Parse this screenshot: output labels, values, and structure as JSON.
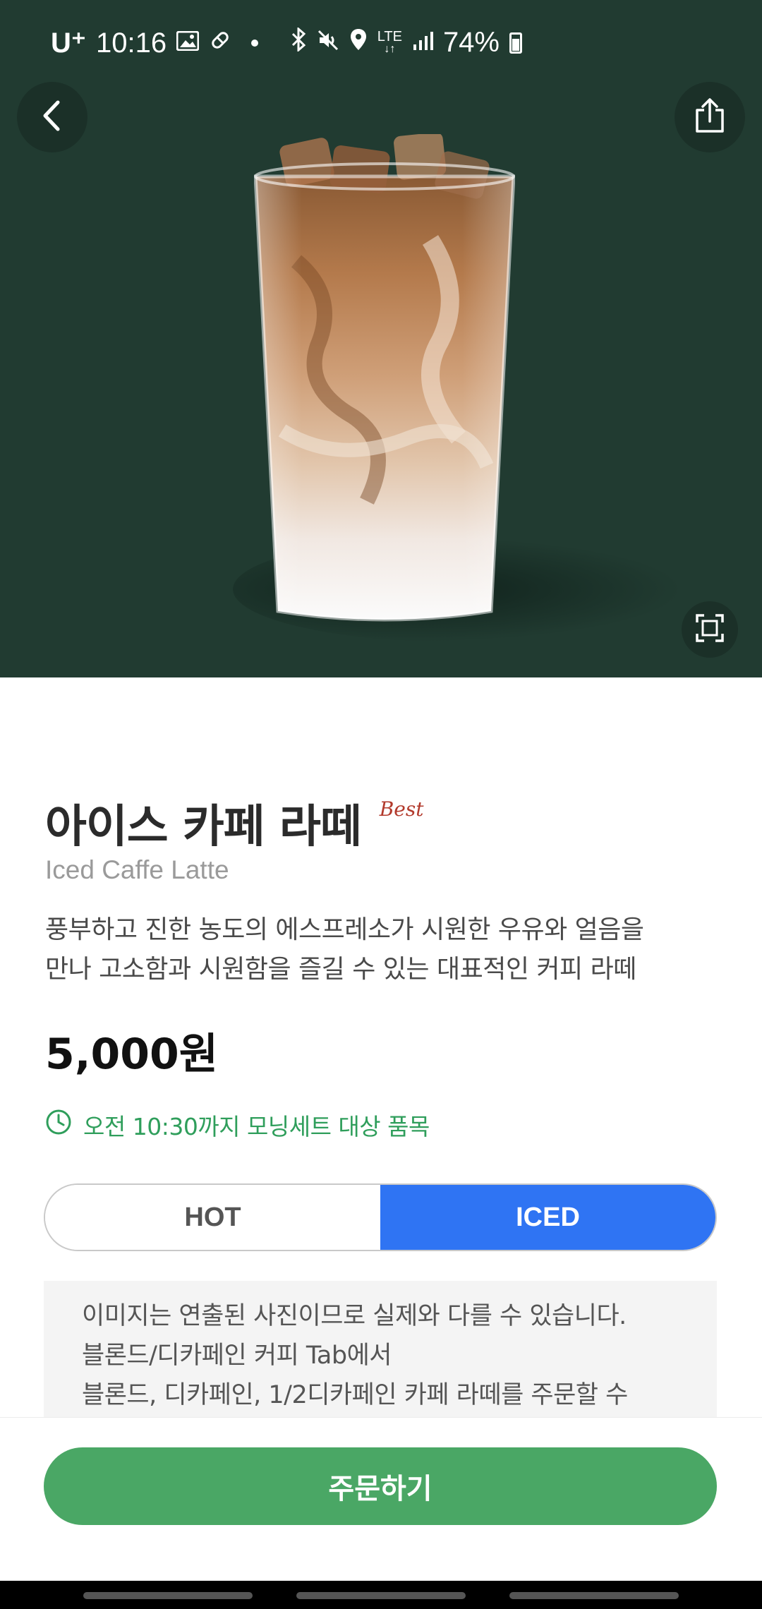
{
  "status_bar": {
    "carrier": "U⁺",
    "time": "10:16",
    "network": "LTE",
    "battery": "74%",
    "icons": [
      "gallery-icon",
      "pill-icon",
      "dot-icon",
      "bluetooth-icon",
      "mute-icon",
      "location-icon",
      "lte-icon",
      "signal-icon",
      "battery-icon"
    ]
  },
  "header": {
    "back_icon": "chevron-left-icon",
    "share_icon": "share-icon",
    "zoom_icon": "fullscreen-icon"
  },
  "product": {
    "name_ko": "아이스 카페 라떼",
    "badge": "Best",
    "name_en": "Iced Caffe Latte",
    "description_line1": "풍부하고 진한 농도의 에스프레소가 시원한 우유와 얼음을",
    "description_line2": "만나 고소함과 시원함을 즐길 수 있는 대표적인 커피 라떼",
    "price": "5,000원",
    "promo": "오전 10:30까지 모닝세트 대상 품목"
  },
  "temperature": {
    "options": [
      "HOT",
      "ICED"
    ],
    "selected": "ICED"
  },
  "notice": {
    "line1": "이미지는 연출된 사진이므로 실제와 다를 수 있습니다.",
    "line2": "블론드/디카페인 커피 Tab에서",
    "line3": "블론드, 디카페인, 1/2디카페인 카페 라떼를 주문할 수"
  },
  "order_button": "주문하기",
  "colors": {
    "hero_bg": "#213b31",
    "accent_green": "#4aa765",
    "promo_green": "#2f9e5b",
    "iced_blue": "#2f74f3",
    "best_red": "#b23a2c"
  }
}
